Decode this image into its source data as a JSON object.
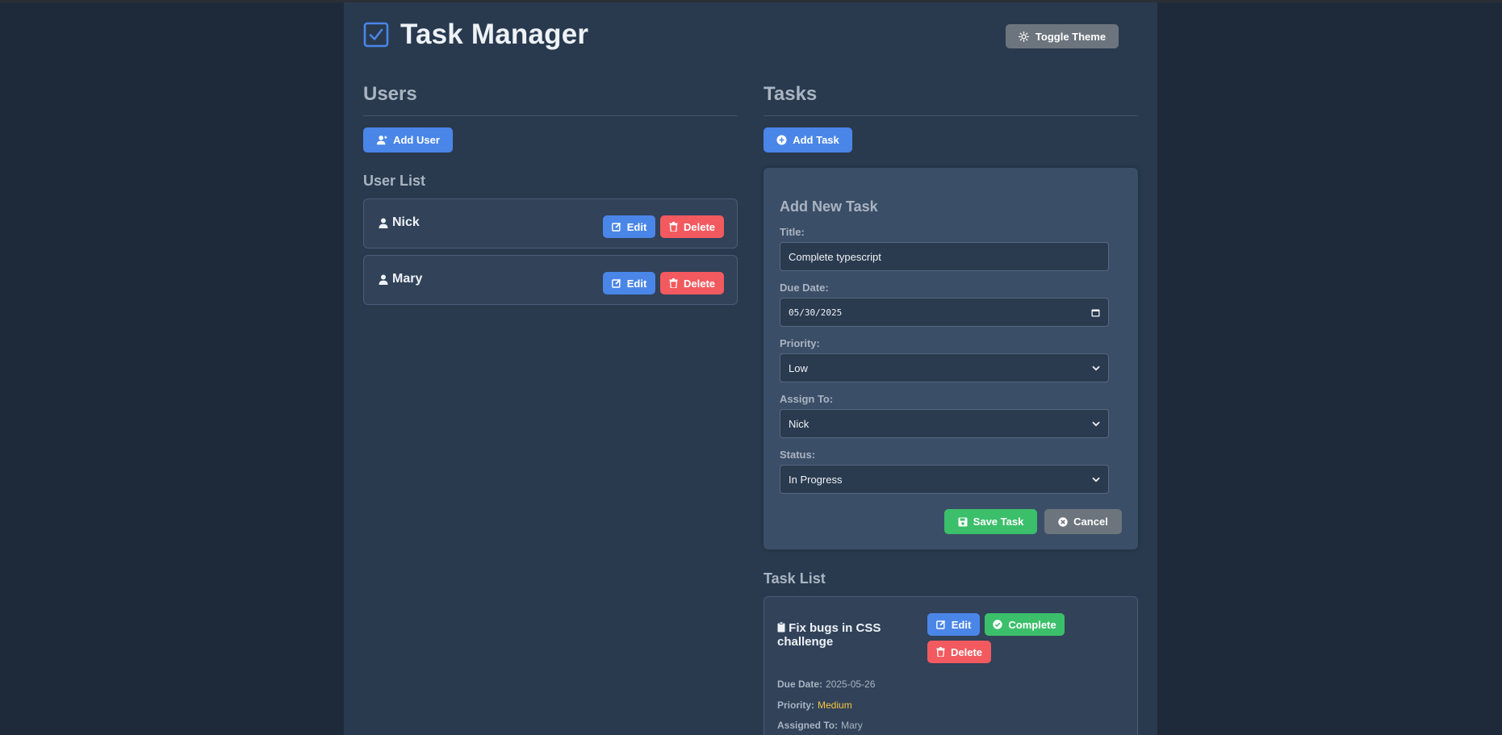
{
  "header": {
    "title": "Task Manager",
    "toggle_theme_label": "Toggle Theme"
  },
  "users": {
    "heading": "Users",
    "add_user_label": "Add User",
    "list_title": "User List",
    "items": [
      {
        "name": "Nick",
        "edit_label": "Edit",
        "delete_label": "Delete"
      },
      {
        "name": "Mary",
        "edit_label": "Edit",
        "delete_label": "Delete"
      }
    ]
  },
  "tasks": {
    "heading": "Tasks",
    "add_task_label": "Add Task",
    "form": {
      "title": "Add New Task",
      "title_label": "Title:",
      "title_value": "Complete typescript",
      "due_date_label": "Due Date:",
      "due_date_value": "05/30/2025",
      "priority_label": "Priority:",
      "priority_value": "Low",
      "assign_label": "Assign To:",
      "assign_value": "Nick",
      "status_label": "Status:",
      "status_value": "In Progress",
      "save_label": "Save Task",
      "cancel_label": "Cancel"
    },
    "list_title": "Task List",
    "items": [
      {
        "title": "Fix bugs in CSS challenge",
        "edit_label": "Edit",
        "complete_label": "Complete",
        "delete_label": "Delete",
        "due_date_label": "Due Date:",
        "due_date": "2025-05-26",
        "priority_label": "Priority:",
        "priority": "Medium",
        "assigned_label": "Assigned To:",
        "assigned_to": "Mary"
      }
    ]
  },
  "colors": {
    "page_bg": "#1e2a3a",
    "panel_bg": "#293a4f",
    "primary": "#4a86e8",
    "danger": "#f25a5f",
    "success": "#3cbf6a",
    "secondary": "#6c757d",
    "priority_medium": "#f5c542"
  }
}
